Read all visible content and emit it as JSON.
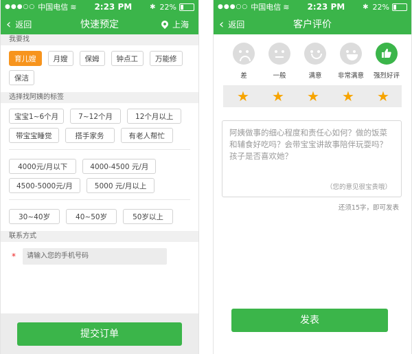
{
  "status": {
    "carrier": "中国电信",
    "time": "2:23 PM",
    "battery": "22%"
  },
  "left": {
    "back_label": "返回",
    "title": "快速预定",
    "location": "上海",
    "section_find": "我要找",
    "find_tags": [
      "育儿嫂",
      "月嫂",
      "保姆",
      "钟点工",
      "万能修",
      "保洁"
    ],
    "selected_find": "育儿嫂",
    "section_tags": "选择找阿姨的标签",
    "care_tags": [
      "宝宝1~6个月",
      "7~12个月",
      "12个月以上",
      "带宝宝睡觉",
      "搭手家务",
      "有老人帮忙"
    ],
    "salary_tags": [
      "4000元/月以下",
      "4000-4500 元/月",
      "4500-5000元/月",
      "5000 元/月以上"
    ],
    "age_tags": [
      "30~40岁",
      "40~50岁",
      "50岁以上"
    ],
    "section_contact": "联系方式",
    "required_mark": "*",
    "phone_placeholder": "请输入您的手机号码",
    "submit_label": "提交订单"
  },
  "right": {
    "back_label": "返回",
    "title": "客户评价",
    "ratings": [
      "差",
      "一般",
      "满意",
      "非常满意",
      "强烈好评"
    ],
    "selected_rating": "强烈好评",
    "stars": [
      "★",
      "★",
      "★",
      "★",
      "★"
    ],
    "stars_filled": 5,
    "review_placeholder": "阿姨做事的细心程度和责任心如何？做的饭菜和辅食好吃吗？会带宝宝讲故事陪伴玩耍吗？孩子是否喜欢她？",
    "review_hint": "（您的意见很宝贵哦）",
    "counter_text": "还须15字，即可发表",
    "publish_label": "发表"
  },
  "colors": {
    "primary": "#3bb54a",
    "accent": "#f7941d",
    "star": "#f7a400",
    "required": "#ee2222"
  }
}
